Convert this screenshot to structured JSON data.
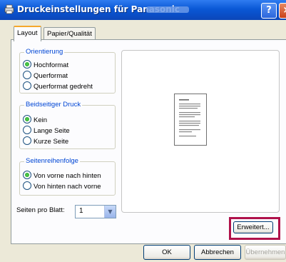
{
  "window": {
    "title": "Druckeinstellungen für Panasonic"
  },
  "titlebar": {
    "help_label": "?",
    "close_label": "×"
  },
  "tabs": [
    {
      "label": "Layout",
      "active": true
    },
    {
      "label": "Papier/Qualität",
      "active": false
    }
  ],
  "orientation": {
    "legend": "Orientierung",
    "options": [
      {
        "label": "Hochformat",
        "selected": true
      },
      {
        "label": "Querformat",
        "selected": false
      },
      {
        "label": "Querformat gedreht",
        "selected": false
      }
    ]
  },
  "duplex": {
    "legend": "Beidseitiger Druck",
    "options": [
      {
        "label": "Kein",
        "selected": true
      },
      {
        "label": "Lange Seite",
        "selected": false
      },
      {
        "label": "Kurze Seite",
        "selected": false
      }
    ]
  },
  "page_order": {
    "legend": "Seitenreihenfolge",
    "options": [
      {
        "label": "Von vorne nach hinten",
        "selected": true
      },
      {
        "label": "Von hinten nach vorne",
        "selected": false
      }
    ]
  },
  "pages_per_sheet": {
    "label": "Seiten pro Blatt:",
    "value": "1"
  },
  "buttons": {
    "advanced": "Erweitert...",
    "ok": "OK",
    "cancel": "Abbrechen",
    "apply": "Übernehmen"
  },
  "colors": {
    "titlebar": "#0a58d6",
    "highlight": "#b0124b",
    "legend": "#0046d5"
  }
}
